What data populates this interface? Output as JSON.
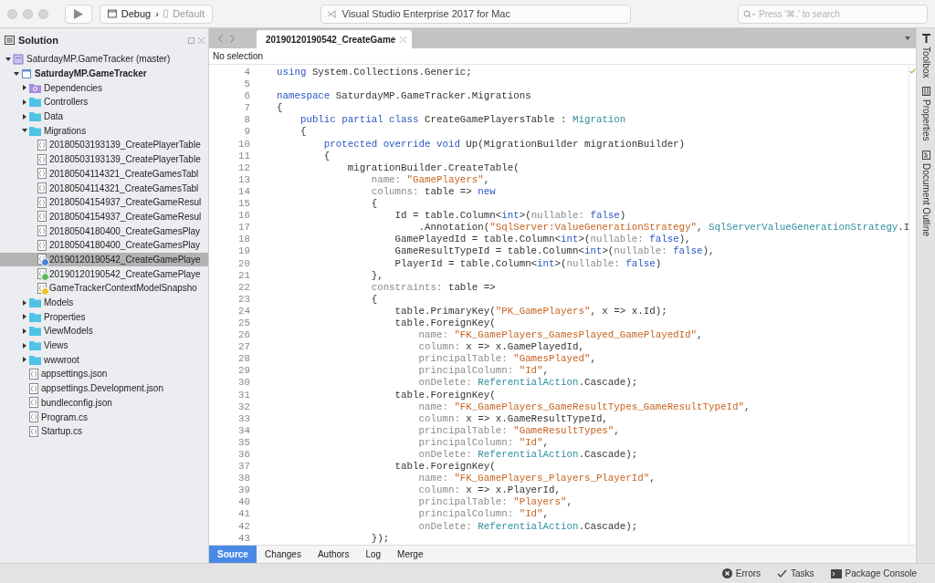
{
  "toolbar": {
    "configuration": "Debug",
    "separator": "›",
    "device": "Default",
    "title": "Visual Studio Enterprise 2017 for Mac",
    "search": {
      "placeholder": "Press '⌘.' to search"
    }
  },
  "sidebar": {
    "title": "Solution",
    "tree": [
      {
        "label": "SaturdayMP.GameTracker (master)",
        "kind": "solution",
        "expanded": true,
        "selected": false,
        "children": [
          {
            "label": "SaturdayMP.GameTracker",
            "kind": "project",
            "bold": true,
            "expanded": true,
            "selected": false,
            "children": [
              {
                "label": "Dependencies",
                "kind": "dependencies",
                "expanded": false,
                "selected": false
              },
              {
                "label": "Controllers",
                "kind": "folder",
                "expanded": false,
                "selected": false
              },
              {
                "label": "Data",
                "kind": "folder",
                "expanded": false,
                "selected": false
              },
              {
                "label": "Migrations",
                "kind": "folder",
                "expanded": true,
                "selected": false,
                "children": [
                  {
                    "label": "20180503193139_CreatePlayerTable",
                    "kind": "file",
                    "selected": false
                  },
                  {
                    "label": "20180503193139_CreatePlayerTable",
                    "kind": "file",
                    "selected": false
                  },
                  {
                    "label": "20180504114321_CreateGamesTabl",
                    "kind": "file",
                    "selected": false
                  },
                  {
                    "label": "20180504114321_CreateGamesTabl",
                    "kind": "file",
                    "selected": false
                  },
                  {
                    "label": "20180504154937_CreateGameResul",
                    "kind": "file",
                    "selected": false
                  },
                  {
                    "label": "20180504154937_CreateGameResul",
                    "kind": "file",
                    "selected": false
                  },
                  {
                    "label": "20180504180400_CreateGamesPlay",
                    "kind": "file",
                    "selected": false
                  },
                  {
                    "label": "20180504180400_CreateGamesPlay",
                    "kind": "file",
                    "selected": false
                  },
                  {
                    "label": "20190120190542_CreateGamePlaye",
                    "kind": "file",
                    "selected": true,
                    "color": "#4a7fd9"
                  },
                  {
                    "label": "20190120190542_CreateGamePlaye",
                    "kind": "file",
                    "selected": false,
                    "color": "#5cb85c"
                  },
                  {
                    "label": "GameTrackerContextModelSnapsho",
                    "kind": "file",
                    "selected": false,
                    "color": "#f0c030"
                  }
                ]
              },
              {
                "label": "Models",
                "kind": "folder",
                "expanded": false,
                "selected": false
              },
              {
                "label": "Properties",
                "kind": "folder",
                "expanded": false,
                "selected": false
              },
              {
                "label": "ViewModels",
                "kind": "folder",
                "expanded": false,
                "selected": false
              },
              {
                "label": "Views",
                "kind": "folder",
                "expanded": false,
                "selected": false
              },
              {
                "label": "wwwroot",
                "kind": "folder",
                "expanded": false,
                "selected": false
              },
              {
                "label": "appsettings.json",
                "kind": "file",
                "selected": false
              },
              {
                "label": "appsettings.Development.json",
                "kind": "file",
                "selected": false
              },
              {
                "label": "bundleconfig.json",
                "kind": "file",
                "selected": false
              },
              {
                "label": "Program.cs",
                "kind": "file",
                "selected": false
              },
              {
                "label": "Startup.cs",
                "kind": "file",
                "selected": false
              }
            ]
          }
        ]
      }
    ]
  },
  "editor": {
    "tab": "20190120190542_CreateGame",
    "status": "No selection",
    "lines": [
      {
        "number": "4",
        "tokens": [
          {
            "kind": "keyword",
            "text": "using"
          },
          {
            "kind": "plain",
            "text": " System.Collections.Generic;"
          }
        ]
      },
      {
        "number": "5"
      },
      {
        "number": "6",
        "tokens": [
          {
            "kind": "keyword",
            "text": "namespace"
          },
          {
            "kind": "plain",
            "text": " SaturdayMP.GameTracker.Migrations"
          }
        ]
      },
      {
        "number": "7",
        "tokens": [
          {
            "kind": "plain",
            "text": "{"
          }
        ]
      },
      {
        "number": "8",
        "tokens": [
          {
            "kind": "keyword",
            "text": "    public partial class"
          },
          {
            "kind": "plain",
            "text": " CreateGamePlayersTable : "
          },
          {
            "kind": "type",
            "text": "Migration"
          }
        ]
      },
      {
        "number": "9",
        "tokens": [
          {
            "kind": "plain",
            "text": "    {"
          }
        ]
      },
      {
        "number": "10",
        "tokens": [
          {
            "kind": "keyword",
            "text": "        protected override void"
          },
          {
            "kind": "plain",
            "text": " Up(MigrationBuilder migrationBuilder)"
          }
        ]
      },
      {
        "number": "11",
        "tokens": [
          {
            "kind": "plain",
            "text": "        {"
          }
        ]
      },
      {
        "number": "12",
        "tokens": [
          {
            "kind": "plain",
            "text": "            migrationBuilder.CreateTable("
          }
        ]
      },
      {
        "number": "13",
        "tokens": [
          {
            "kind": "label",
            "text": "                name: "
          },
          {
            "kind": "string",
            "text": "\"GamePlayers\""
          },
          {
            "kind": "plain",
            "text": ","
          }
        ]
      },
      {
        "number": "14",
        "tokens": [
          {
            "kind": "label",
            "text": "                columns:"
          },
          {
            "kind": "plain",
            "text": " table => "
          },
          {
            "kind": "keyword",
            "text": "new"
          }
        ]
      },
      {
        "number": "15",
        "tokens": [
          {
            "kind": "plain",
            "text": "                {"
          }
        ]
      },
      {
        "number": "16",
        "tokens": [
          {
            "kind": "plain",
            "text": "                    Id = table.Column<"
          },
          {
            "kind": "keyword",
            "text": "int"
          },
          {
            "kind": "plain",
            "text": ">("
          },
          {
            "kind": "label",
            "text": "nullable: "
          },
          {
            "kind": "keyword",
            "text": "false"
          },
          {
            "kind": "plain",
            "text": ")"
          }
        ]
      },
      {
        "number": "17",
        "tokens": [
          {
            "kind": "plain",
            "text": "                        .Annotation("
          },
          {
            "kind": "string",
            "text": "\"SqlServer:ValueGenerationStrategy\""
          },
          {
            "kind": "plain",
            "text": ", "
          },
          {
            "kind": "type",
            "text": "SqlServerValueGenerationStrategy"
          },
          {
            "kind": "plain",
            "text": ".I"
          }
        ]
      },
      {
        "number": "18",
        "tokens": [
          {
            "kind": "plain",
            "text": "                    GamePlayedId = table.Column<"
          },
          {
            "kind": "keyword",
            "text": "int"
          },
          {
            "kind": "plain",
            "text": ">("
          },
          {
            "kind": "label",
            "text": "nullable: "
          },
          {
            "kind": "keyword",
            "text": "false"
          },
          {
            "kind": "plain",
            "text": "),"
          }
        ]
      },
      {
        "number": "19",
        "tokens": [
          {
            "kind": "plain",
            "text": "                    GameResultTypeId = table.Column<"
          },
          {
            "kind": "keyword",
            "text": "int"
          },
          {
            "kind": "plain",
            "text": ">("
          },
          {
            "kind": "label",
            "text": "nullable: "
          },
          {
            "kind": "keyword",
            "text": "false"
          },
          {
            "kind": "plain",
            "text": "),"
          }
        ]
      },
      {
        "number": "20",
        "tokens": [
          {
            "kind": "plain",
            "text": "                    PlayerId = table.Column<"
          },
          {
            "kind": "keyword",
            "text": "int"
          },
          {
            "kind": "plain",
            "text": ">("
          },
          {
            "kind": "label",
            "text": "nullable: "
          },
          {
            "kind": "keyword",
            "text": "false"
          },
          {
            "kind": "plain",
            "text": ")"
          }
        ]
      },
      {
        "number": "21",
        "tokens": [
          {
            "kind": "plain",
            "text": "                },"
          }
        ]
      },
      {
        "number": "22",
        "tokens": [
          {
            "kind": "label",
            "text": "                constraints:"
          },
          {
            "kind": "plain",
            "text": " table =>"
          }
        ]
      },
      {
        "number": "23",
        "tokens": [
          {
            "kind": "plain",
            "text": "                {"
          }
        ]
      },
      {
        "number": "24",
        "tokens": [
          {
            "kind": "plain",
            "text": "                    table.PrimaryKey("
          },
          {
            "kind": "string",
            "text": "\"PK_GamePlayers\""
          },
          {
            "kind": "plain",
            "text": ", x => x.Id);"
          }
        ]
      },
      {
        "number": "25",
        "tokens": [
          {
            "kind": "plain",
            "text": "                    table.ForeignKey("
          }
        ]
      },
      {
        "number": "26",
        "tokens": [
          {
            "kind": "label",
            "text": "                        name: "
          },
          {
            "kind": "string",
            "text": "\"FK_GamePlayers_GamesPlayed_GamePlayedId\""
          },
          {
            "kind": "plain",
            "text": ","
          }
        ]
      },
      {
        "number": "27",
        "tokens": [
          {
            "kind": "label",
            "text": "                        column:"
          },
          {
            "kind": "plain",
            "text": " x => x.GamePlayedId,"
          }
        ]
      },
      {
        "number": "28",
        "tokens": [
          {
            "kind": "label",
            "text": "                        principalTable: "
          },
          {
            "kind": "string",
            "text": "\"GamesPlayed\""
          },
          {
            "kind": "plain",
            "text": ","
          }
        ]
      },
      {
        "number": "29",
        "tokens": [
          {
            "kind": "label",
            "text": "                        principalColumn: "
          },
          {
            "kind": "string",
            "text": "\"Id\""
          },
          {
            "kind": "plain",
            "text": ","
          }
        ]
      },
      {
        "number": "30",
        "tokens": [
          {
            "kind": "label",
            "text": "                        onDelete: "
          },
          {
            "kind": "type",
            "text": "ReferentialAction"
          },
          {
            "kind": "plain",
            "text": ".Cascade);"
          }
        ]
      },
      {
        "number": "31",
        "tokens": [
          {
            "kind": "plain",
            "text": "                    table.ForeignKey("
          }
        ]
      },
      {
        "number": "32",
        "tokens": [
          {
            "kind": "label",
            "text": "                        name: "
          },
          {
            "kind": "string",
            "text": "\"FK_GamePlayers_GameResultTypes_GameResultTypeId\""
          },
          {
            "kind": "plain",
            "text": ","
          }
        ]
      },
      {
        "number": "33",
        "tokens": [
          {
            "kind": "label",
            "text": "                        column:"
          },
          {
            "kind": "plain",
            "text": " x => x.GameResultTypeId,"
          }
        ]
      },
      {
        "number": "34",
        "tokens": [
          {
            "kind": "label",
            "text": "                        principalTable: "
          },
          {
            "kind": "string",
            "text": "\"GameResultTypes\""
          },
          {
            "kind": "plain",
            "text": ","
          }
        ]
      },
      {
        "number": "35",
        "tokens": [
          {
            "kind": "label",
            "text": "                        principalColumn: "
          },
          {
            "kind": "string",
            "text": "\"Id\""
          },
          {
            "kind": "plain",
            "text": ","
          }
        ]
      },
      {
        "number": "36",
        "tokens": [
          {
            "kind": "label",
            "text": "                        onDelete: "
          },
          {
            "kind": "type",
            "text": "ReferentialAction"
          },
          {
            "kind": "plain",
            "text": ".Cascade);"
          }
        ]
      },
      {
        "number": "37",
        "tokens": [
          {
            "kind": "plain",
            "text": "                    table.ForeignKey("
          }
        ]
      },
      {
        "number": "38",
        "tokens": [
          {
            "kind": "label",
            "text": "                        name: "
          },
          {
            "kind": "string",
            "text": "\"FK_GamePlayers_Players_PlayerId\""
          },
          {
            "kind": "plain",
            "text": ","
          }
        ]
      },
      {
        "number": "39",
        "tokens": [
          {
            "kind": "label",
            "text": "                        column:"
          },
          {
            "kind": "plain",
            "text": " x => x.PlayerId,"
          }
        ]
      },
      {
        "number": "40",
        "tokens": [
          {
            "kind": "label",
            "text": "                        principalTable: "
          },
          {
            "kind": "string",
            "text": "\"Players\""
          },
          {
            "kind": "plain",
            "text": ","
          }
        ]
      },
      {
        "number": "41",
        "tokens": [
          {
            "kind": "label",
            "text": "                        principalColumn: "
          },
          {
            "kind": "string",
            "text": "\"Id\""
          },
          {
            "kind": "plain",
            "text": ","
          }
        ]
      },
      {
        "number": "42",
        "tokens": [
          {
            "kind": "label",
            "text": "                        onDelete: "
          },
          {
            "kind": "type",
            "text": "ReferentialAction"
          },
          {
            "kind": "plain",
            "text": ".Cascade);"
          }
        ]
      },
      {
        "number": "43",
        "tokens": [
          {
            "kind": "plain",
            "text": "                });"
          }
        ]
      }
    ],
    "bottom_tabs": [
      {
        "label": "Source",
        "selected": true
      },
      {
        "label": "Changes",
        "selected": false
      },
      {
        "label": "Authors",
        "selected": false
      },
      {
        "label": "Log",
        "selected": false
      },
      {
        "label": "Merge",
        "selected": false
      }
    ]
  },
  "right_pads": [
    {
      "label": "Toolbox",
      "kind": "toolbox"
    },
    {
      "label": "Properties",
      "kind": "properties"
    },
    {
      "label": "Document Outline",
      "kind": "outline"
    }
  ],
  "status_bar": [
    {
      "label": "Errors",
      "kind": "errors"
    },
    {
      "label": "Tasks",
      "kind": "tasks"
    },
    {
      "label": "Package Console",
      "kind": "console"
    }
  ]
}
